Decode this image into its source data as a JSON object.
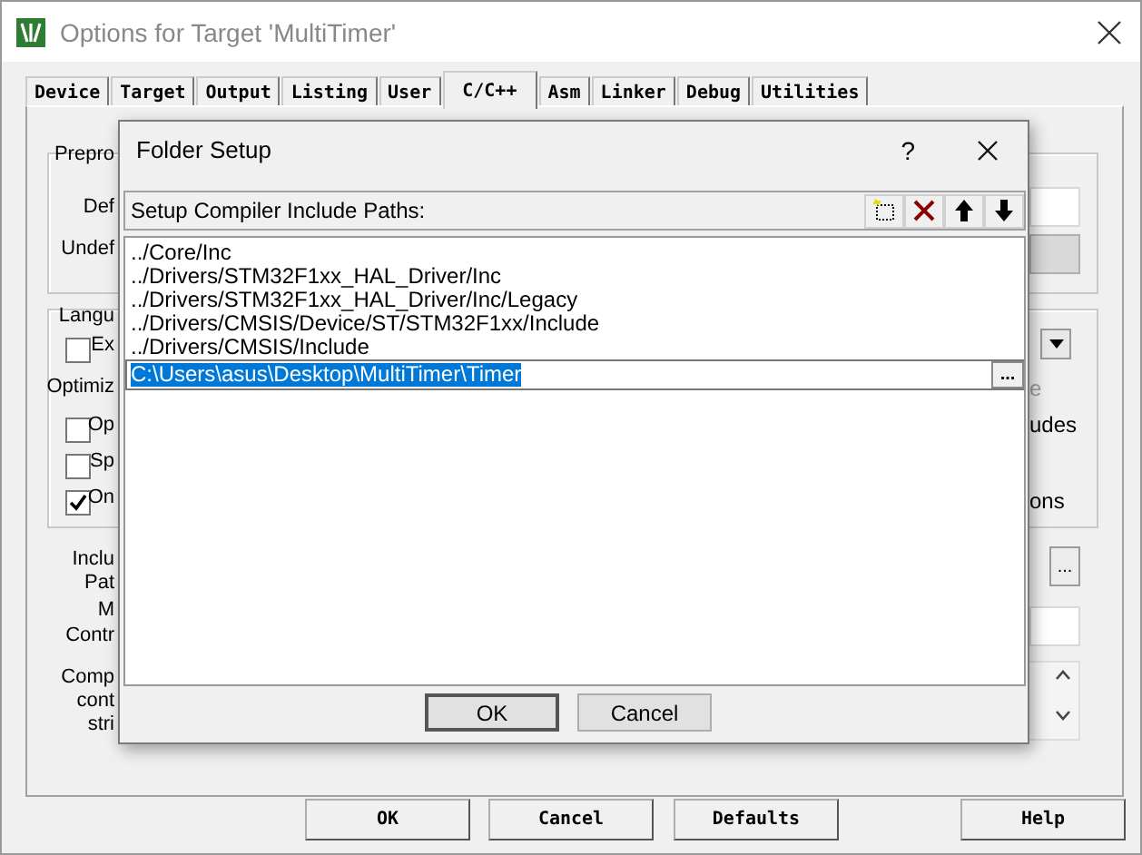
{
  "window": {
    "title": "Options for Target 'MultiTimer'"
  },
  "tabs": [
    {
      "label": "Device",
      "selected": false
    },
    {
      "label": "Target",
      "selected": false
    },
    {
      "label": "Output",
      "selected": false
    },
    {
      "label": "Listing",
      "selected": false
    },
    {
      "label": "User",
      "selected": false
    },
    {
      "label": "C/C++",
      "selected": true
    },
    {
      "label": "Asm",
      "selected": false
    },
    {
      "label": "Linker",
      "selected": false
    },
    {
      "label": "Debug",
      "selected": false
    },
    {
      "label": "Utilities",
      "selected": false
    }
  ],
  "options_panel": {
    "preprocessor_group": {
      "label": "Prepro",
      "fields": [
        {
          "label": "Def",
          "disabled": false
        },
        {
          "label": "Undef",
          "disabled": true
        }
      ]
    },
    "language_group": {
      "label": "Langu",
      "optimization_label": "Optimiz",
      "checkboxes": [
        {
          "label": "Ex",
          "checked": false
        },
        {
          "label": "Op",
          "checked": false
        },
        {
          "label": "Sp",
          "checked": false
        },
        {
          "label": "On",
          "checked": true
        }
      ],
      "right_texts": [
        {
          "text": "e",
          "disabled": true
        },
        {
          "text": "udes",
          "disabled": false
        },
        {
          "text": "ons",
          "disabled": false
        }
      ]
    },
    "lower_labels": [
      "Inclu",
      "Pat",
      "M",
      "Contr",
      "Comp",
      "cont",
      "stri"
    ],
    "browse_button": "..."
  },
  "folder_dialog": {
    "title": "Folder Setup",
    "help": "?",
    "header": "Setup Compiler Include Paths:",
    "paths": [
      {
        "kind": "text",
        "text": "../Core/Inc",
        "selected": false
      },
      {
        "kind": "text",
        "text": "../Drivers/STM32F1xx_HAL_Driver/Inc",
        "selected": false
      },
      {
        "kind": "text",
        "text": "../Drivers/STM32F1xx_HAL_Driver/Inc/Legacy",
        "selected": false
      },
      {
        "kind": "text",
        "text": "../Drivers/CMSIS/Device/ST/STM32F1xx/Include",
        "selected": false
      },
      {
        "kind": "text",
        "text": "../Drivers/CMSIS/Include",
        "selected": false
      },
      {
        "kind": "editor",
        "text": "C:\\Users\\asus\\Desktop\\MultiTimer\\Timer",
        "selected": true,
        "browse": "..."
      }
    ],
    "buttons": [
      "OK",
      "Cancel"
    ]
  },
  "footer_buttons": [
    "OK",
    "Cancel",
    "Defaults",
    "Help"
  ]
}
